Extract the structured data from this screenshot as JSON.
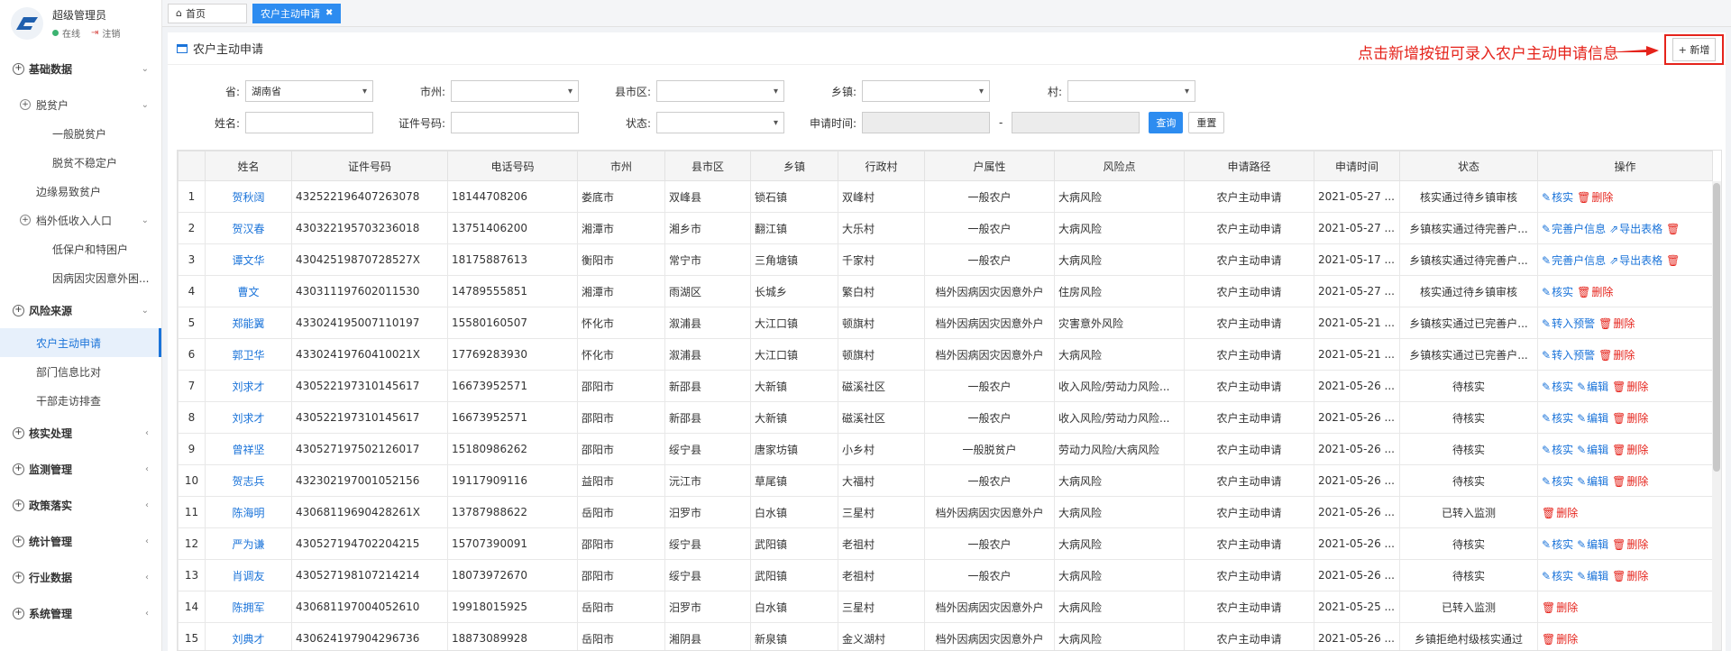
{
  "user": {
    "name": "超级管理员",
    "status": "在线",
    "logout": "注销"
  },
  "sidebar": {
    "base_data": "基础数据",
    "poverty": "脱贫户",
    "general_poverty": "一般脱贫户",
    "unstable_poverty": "脱贫不稳定户",
    "edge": "边缘易致贫户",
    "low_income": "档外低收入人口",
    "dibao": "低保户和特困户",
    "illness": "因病因灾因意外困...",
    "risk_source": "风险来源",
    "farmer_apply": "农户主动申请",
    "dept_compare": "部门信息比对",
    "cadre_visit": "干部走访排查",
    "verify": "核实处理",
    "monitor": "监测管理",
    "policy": "政策落实",
    "stats": "统计管理",
    "industry": "行业数据",
    "system": "系统管理"
  },
  "tabs": {
    "home": "首页",
    "current": "农户主动申请"
  },
  "panel": {
    "title": "农户主动申请",
    "annotation": "点击新增按钮可录入农户主动申请信息",
    "add_button": "+ 新增"
  },
  "form": {
    "province_label": "省:",
    "province_value": "湖南省",
    "city_label": "市州:",
    "county_label": "县市区:",
    "town_label": "乡镇:",
    "village_label": "村:",
    "name_label": "姓名:",
    "id_label": "证件号码:",
    "status_label": "状态:",
    "time_label": "申请时间:",
    "dash": "-",
    "query": "查询",
    "reset": "重置"
  },
  "table": {
    "headers": [
      "",
      "姓名",
      "证件号码",
      "电话号码",
      "市州",
      "县市区",
      "乡镇",
      "行政村",
      "户属性",
      "风险点",
      "申请路径",
      "申请时间",
      "状态",
      "操作"
    ],
    "rows": [
      {
        "no": "1",
        "name": "贺秋阔",
        "id": "432522196407263078",
        "phone": "18144708206",
        "city": "娄底市",
        "county": "双峰县",
        "town": "锁石镇",
        "village": "双峰村",
        "attr": "一般农户",
        "risk": "大病风险",
        "path": "农户主动申请",
        "time": "2021-05-27 ...",
        "status": "核实通过待乡镇审核",
        "ops": [
          "核实",
          "删除"
        ]
      },
      {
        "no": "2",
        "name": "贺汉春",
        "id": "430322195703236018",
        "phone": "13751406200",
        "city": "湘潭市",
        "county": "湘乡市",
        "town": "翻江镇",
        "village": "大乐村",
        "attr": "一般农户",
        "risk": "大病风险",
        "path": "农户主动申请",
        "time": "2021-05-27 ...",
        "status": "乡镇核实通过待完善户...",
        "ops": [
          "完善户信息",
          "导出表格",
          ""
        ]
      },
      {
        "no": "3",
        "name": "谭文华",
        "id": "43042519870728527X",
        "phone": "18175887613",
        "city": "衡阳市",
        "county": "常宁市",
        "town": "三角塘镇",
        "village": "千家村",
        "attr": "一般农户",
        "risk": "大病风险",
        "path": "农户主动申请",
        "time": "2021-05-17 ...",
        "status": "乡镇核实通过待完善户...",
        "ops": [
          "完善户信息",
          "导出表格",
          ""
        ]
      },
      {
        "no": "4",
        "name": "曹文",
        "id": "430311197602011530",
        "phone": "14789555851",
        "city": "湘潭市",
        "county": "雨湖区",
        "town": "长城乡",
        "village": "繁白村",
        "attr": "档外因病因灾因意外户",
        "risk": "住房风险",
        "path": "农户主动申请",
        "time": "2021-05-27 ...",
        "status": "核实通过待乡镇审核",
        "ops": [
          "核实",
          "删除"
        ]
      },
      {
        "no": "5",
        "name": "郑能翼",
        "id": "433024195007110197",
        "phone": "15580160507",
        "city": "怀化市",
        "county": "溆浦县",
        "town": "大江口镇",
        "village": "顿旗村",
        "attr": "档外因病因灾因意外户",
        "risk": "灾害意外风险",
        "path": "农户主动申请",
        "time": "2021-05-21 ...",
        "status": "乡镇核实通过已完善户...",
        "ops": [
          "转入预警",
          "删除"
        ]
      },
      {
        "no": "6",
        "name": "郭卫华",
        "id": "43302419760410021X",
        "phone": "17769283930",
        "city": "怀化市",
        "county": "溆浦县",
        "town": "大江口镇",
        "village": "顿旗村",
        "attr": "档外因病因灾因意外户",
        "risk": "大病风险",
        "path": "农户主动申请",
        "time": "2021-05-21 ...",
        "status": "乡镇核实通过已完善户...",
        "ops": [
          "转入预警",
          "删除"
        ]
      },
      {
        "no": "7",
        "name": "刘求才",
        "id": "430522197310145617",
        "phone": "16673952571",
        "city": "邵阳市",
        "county": "新邵县",
        "town": "大新镇",
        "village": "磁溪社区",
        "attr": "一般农户",
        "risk": "收入风险/劳动力风险...",
        "path": "农户主动申请",
        "time": "2021-05-26 ...",
        "status": "待核实",
        "ops": [
          "核实",
          "编辑",
          "删除"
        ]
      },
      {
        "no": "8",
        "name": "刘求才",
        "id": "430522197310145617",
        "phone": "16673952571",
        "city": "邵阳市",
        "county": "新邵县",
        "town": "大新镇",
        "village": "磁溪社区",
        "attr": "一般农户",
        "risk": "收入风险/劳动力风险...",
        "path": "农户主动申请",
        "time": "2021-05-26 ...",
        "status": "待核实",
        "ops": [
          "核实",
          "编辑",
          "删除"
        ]
      },
      {
        "no": "9",
        "name": "曾祥坚",
        "id": "430527197502126017",
        "phone": "15180986262",
        "city": "邵阳市",
        "county": "绥宁县",
        "town": "唐家坊镇",
        "village": "小乡村",
        "attr": "一般脱贫户",
        "risk": "劳动力风险/大病风险",
        "path": "农户主动申请",
        "time": "2021-05-26 ...",
        "status": "待核实",
        "ops": [
          "核实",
          "编辑",
          "删除"
        ]
      },
      {
        "no": "10",
        "name": "贺志兵",
        "id": "432302197001052156",
        "phone": "19117909116",
        "city": "益阳市",
        "county": "沅江市",
        "town": "草尾镇",
        "village": "大福村",
        "attr": "一般农户",
        "risk": "大病风险",
        "path": "农户主动申请",
        "time": "2021-05-26 ...",
        "status": "待核实",
        "ops": [
          "核实",
          "编辑",
          "删除"
        ]
      },
      {
        "no": "11",
        "name": "陈海明",
        "id": "43068119690428261X",
        "phone": "13787988622",
        "city": "岳阳市",
        "county": "汨罗市",
        "town": "白水镇",
        "village": "三星村",
        "attr": "档外因病因灾因意外户",
        "risk": "大病风险",
        "path": "农户主动申请",
        "time": "2021-05-26 ...",
        "status": "已转入监测",
        "ops": [
          "删除"
        ]
      },
      {
        "no": "12",
        "name": "严为谦",
        "id": "430527194702204215",
        "phone": "15707390091",
        "city": "邵阳市",
        "county": "绥宁县",
        "town": "武阳镇",
        "village": "老祖村",
        "attr": "一般农户",
        "risk": "大病风险",
        "path": "农户主动申请",
        "time": "2021-05-26 ...",
        "status": "待核实",
        "ops": [
          "核实",
          "编辑",
          "删除"
        ]
      },
      {
        "no": "13",
        "name": "肖调友",
        "id": "430527198107214214",
        "phone": "18073972670",
        "city": "邵阳市",
        "county": "绥宁县",
        "town": "武阳镇",
        "village": "老祖村",
        "attr": "一般农户",
        "risk": "大病风险",
        "path": "农户主动申请",
        "time": "2021-05-26 ...",
        "status": "待核实",
        "ops": [
          "核实",
          "编辑",
          "删除"
        ]
      },
      {
        "no": "14",
        "name": "陈拥军",
        "id": "430681197004052610",
        "phone": "19918015925",
        "city": "岳阳市",
        "county": "汨罗市",
        "town": "白水镇",
        "village": "三星村",
        "attr": "档外因病因灾因意外户",
        "risk": "大病风险",
        "path": "农户主动申请",
        "time": "2021-05-25 ...",
        "status": "已转入监测",
        "ops": [
          "删除"
        ]
      },
      {
        "no": "15",
        "name": "刘典才",
        "id": "430624197904296736",
        "phone": "18873089928",
        "city": "岳阳市",
        "county": "湘阴县",
        "town": "新泉镇",
        "village": "金义湖村",
        "attr": "档外因病因灾因意外户",
        "risk": "大病风险",
        "path": "农户主动申请",
        "time": "2021-05-26 ...",
        "status": "乡镇拒绝村级核实通过",
        "ops": [
          "删除"
        ]
      }
    ]
  }
}
